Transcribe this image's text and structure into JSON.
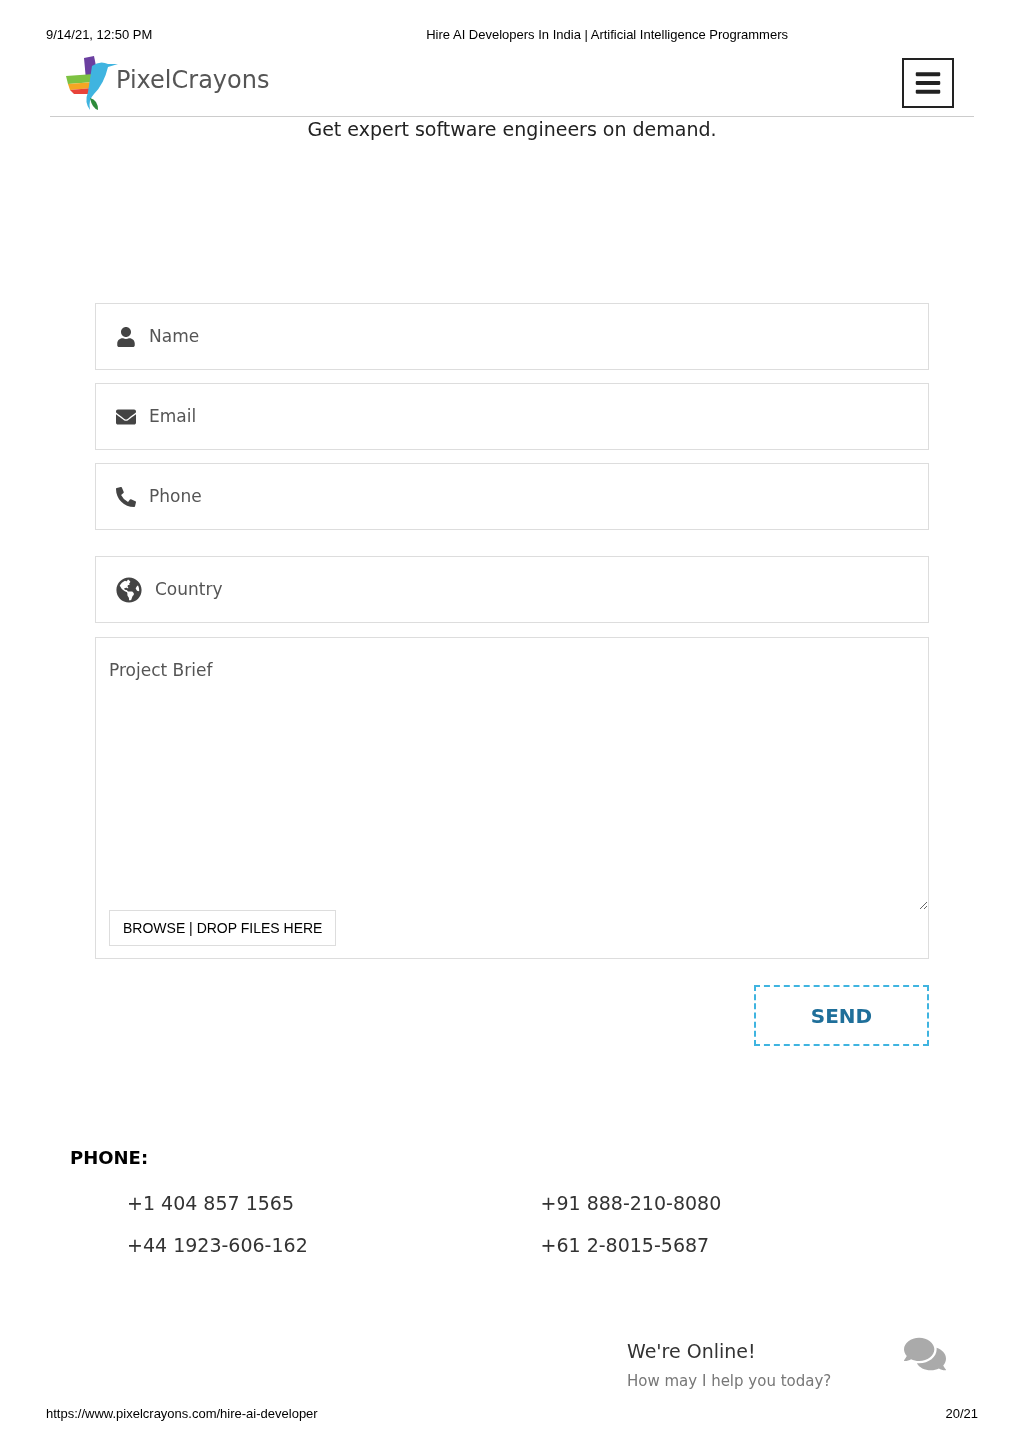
{
  "print_header": {
    "date": "9/14/21, 12:50 PM",
    "title": "Hire AI Developers In India | Artificial Intelligence Programmers"
  },
  "logo": {
    "text": "PixelCrayons"
  },
  "tagline": "Get expert software engineers on demand.",
  "form": {
    "fields": [
      {
        "kind": "name",
        "placeholder": "Name"
      },
      {
        "kind": "email",
        "placeholder": "Email"
      },
      {
        "kind": "phone",
        "placeholder": "Phone"
      },
      {
        "kind": "country",
        "placeholder": "Country"
      }
    ],
    "brief": {
      "placeholder": "Project Brief"
    },
    "upload": "BROWSE | DROP FILES HERE",
    "submit": "SEND"
  },
  "contact": {
    "heading": "PHONE:",
    "numbers": [
      "+1 404 857 1565",
      "+91 888-210-8080",
      "+44 1923-606-162",
      "+61 2-8015-5687"
    ]
  },
  "chat": {
    "title": "We're Online!",
    "subtitle": "How may I help you today?"
  },
  "print_footer": {
    "url": "https://www.pixelcrayons.com/hire-ai-developer",
    "page": "20/21"
  }
}
